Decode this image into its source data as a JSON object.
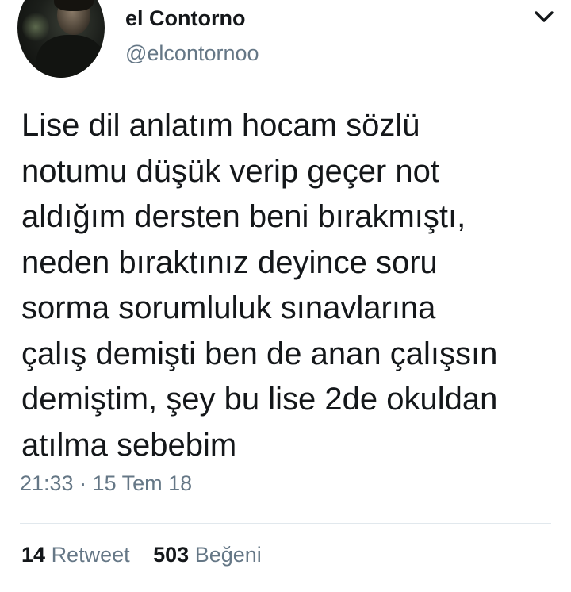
{
  "author": {
    "display_name": "el Contorno",
    "handle": "@elcontornoo",
    "avatar_icon": "profile-photo"
  },
  "menu": {
    "icon": "chevron-down-icon"
  },
  "tweet": {
    "text": "Lise dil anlatım hocam sözlü\nnotumu düşük verip geçer not\naldığım dersten beni bırakmıştı,\nneden bıraktınız deyince soru\nsorma sorumluluk sınavlarına\nçalış demişti ben de anan çalışsın\ndemiştim, şey bu lise 2de okuldan\natılma sebebim",
    "timestamp": "21:33 · 15 Tem 18"
  },
  "stats": {
    "retweet_count": "14",
    "retweet_label": "Retweet",
    "like_count": "503",
    "like_label": "Beğeni"
  },
  "colors": {
    "text_primary": "#14171a",
    "text_secondary": "#657786",
    "divider": "#e1e8ed",
    "background": "#ffffff"
  }
}
